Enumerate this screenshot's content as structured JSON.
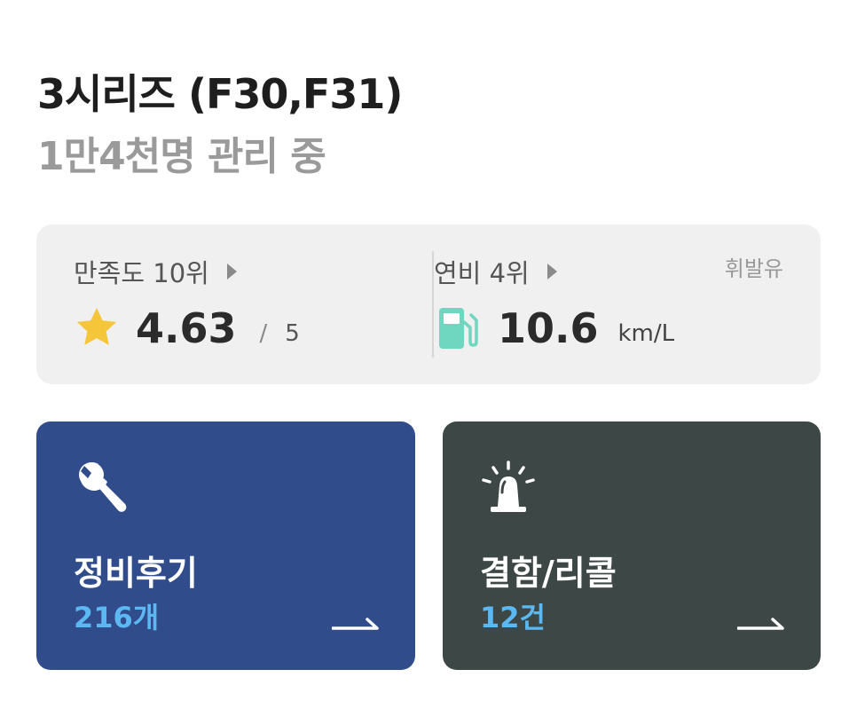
{
  "header": {
    "title": "3시리즈 (F30,F31)",
    "subtitle": "1만4천명  관리 중"
  },
  "stats": {
    "satisfaction": {
      "label": "만족도 10위",
      "rating": "4.63",
      "separator": "/",
      "max": "5",
      "icon": "star-icon"
    },
    "fuel_economy": {
      "label": "연비 4위",
      "fuel_type": "휘발유",
      "value": "10.6",
      "unit": "km/L",
      "icon": "fuel-pump-icon"
    }
  },
  "cards": {
    "maintenance": {
      "title": "정비후기",
      "count": "216개",
      "icon": "wrench-icon",
      "color": "#304c8a"
    },
    "recall": {
      "title": "결함/리콜",
      "count": "12건",
      "icon": "siren-icon",
      "color": "#3d4745"
    }
  },
  "colors": {
    "count_accent": "#5cb8f2",
    "star": "#f5c53a",
    "pump": "#6fd6c0"
  }
}
